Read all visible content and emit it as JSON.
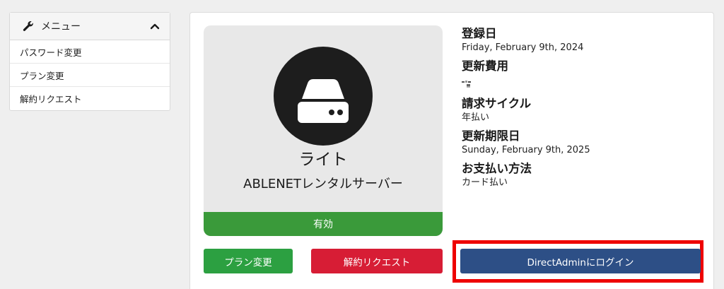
{
  "sidebar": {
    "title": "メニュー",
    "icon": "wrench-icon",
    "toggle_icon": "chevron-up-icon",
    "items": [
      {
        "label": "パスワード変更"
      },
      {
        "label": "プラン変更"
      },
      {
        "label": "解約リクエスト"
      }
    ]
  },
  "product": {
    "icon": "server-icon",
    "name": "ライト",
    "provider": "ABLENETレンタルサーバー",
    "status": "有効",
    "status_color": "#3a9a3a"
  },
  "details": {
    "registered_label": "登録日",
    "registered_value": "Friday, February 9th, 2024",
    "renewal_fee_label": "更新費用",
    "billing_cycle_label": "請求サイクル",
    "billing_cycle_value": "年払い",
    "renewal_due_label": "更新期限日",
    "renewal_due_value": "Sunday, February 9th, 2025",
    "payment_method_label": "お支払い方法",
    "payment_method_value": "カード払い"
  },
  "actions": {
    "change_plan": "プラン変更",
    "cancel_request": "解約リクエスト",
    "directadmin_login": "DirectAdminにログイン"
  },
  "colors": {
    "green": "#2ca041",
    "red": "#d71d35",
    "navy": "#2d4f86",
    "highlight": "#ee0000"
  }
}
